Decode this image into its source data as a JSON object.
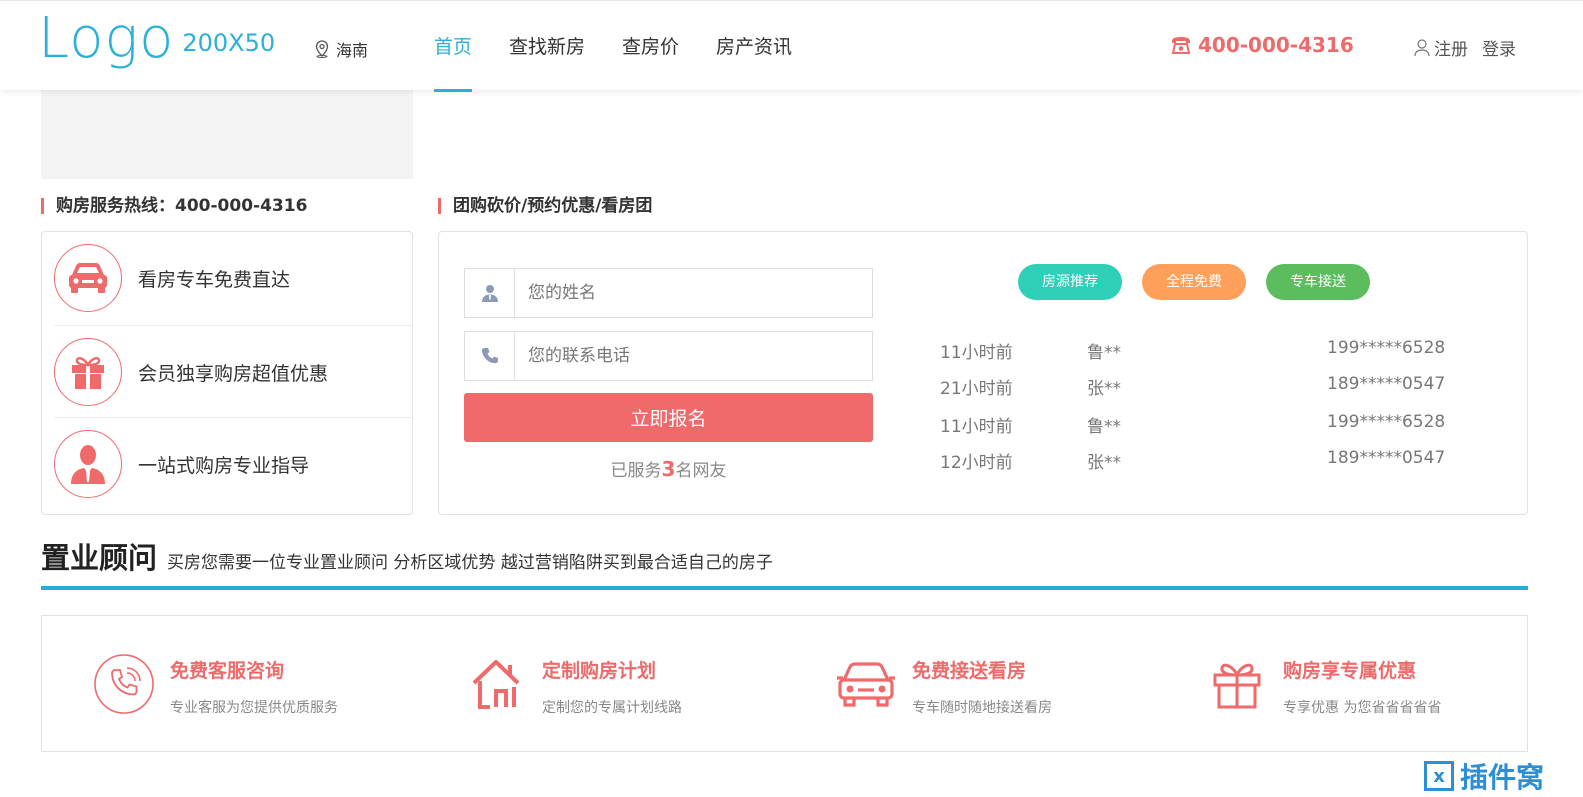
{
  "header": {
    "logo_main": "Logo",
    "logo_sub": "200X50",
    "city": "海南",
    "nav": [
      {
        "label": "首页",
        "active": true
      },
      {
        "label": "查找新房",
        "active": false
      },
      {
        "label": "查房价",
        "active": false
      },
      {
        "label": "房产资讯",
        "active": false
      }
    ],
    "phone": "400-000-4316",
    "register": "注册",
    "login": "登录"
  },
  "left_section": {
    "title": "购房服务热线：400-000-4316",
    "features": [
      {
        "label": "看房专车免费直达",
        "icon": "car-icon"
      },
      {
        "label": "会员独享购房超值优惠",
        "icon": "gift-icon"
      },
      {
        "label": "一站式购房专业指导",
        "icon": "advisor-icon"
      }
    ]
  },
  "right_section": {
    "title": "团购砍价/预约优惠/看房团",
    "name_placeholder": "您的姓名",
    "phone_placeholder": "您的联系电话",
    "submit_label": "立即报名",
    "served_prefix": "已服务",
    "served_count": "3",
    "served_suffix": "名网友",
    "tags": [
      {
        "label": "房源推荐",
        "color": "#2ed1b8"
      },
      {
        "label": "全程免费",
        "color": "#ffa05a"
      },
      {
        "label": "专车接送",
        "color": "#5cbd5f"
      }
    ],
    "records": [
      {
        "time": "11小时前",
        "name": "鲁**",
        "phone": "199*****6528"
      },
      {
        "time": "21小时前",
        "name": "张**",
        "phone": "189*****0547"
      },
      {
        "time": "11小时前",
        "name": "鲁**",
        "phone": "199*****6528"
      },
      {
        "time": "12小时前",
        "name": "张**",
        "phone": "189*****0547"
      }
    ]
  },
  "consultant": {
    "title": "置业顾问",
    "subtitle": "买房您需要一位专业置业顾问 分析区域优势 越过营销陷阱买到最合适自己的房子",
    "services": [
      {
        "title": "免费客服咨询",
        "desc": "专业客服为您提供优质服务",
        "icon": "phone-circle-icon"
      },
      {
        "title": "定制购房计划",
        "desc": "定制您的专属计划线路",
        "icon": "house-icon"
      },
      {
        "title": "免费接送看房",
        "desc": "专车随时随地接送看房",
        "icon": "car-icon"
      },
      {
        "title": "购房享专属优惠",
        "desc": "专享优惠 为您省省省省省",
        "icon": "gift-icon"
      }
    ]
  },
  "watermark": {
    "box": "x",
    "text": "插件窝"
  },
  "colors": {
    "accent_blue": "#2bb0d8",
    "accent_red": "#ef6a6a",
    "button_red": "#f0696b"
  }
}
